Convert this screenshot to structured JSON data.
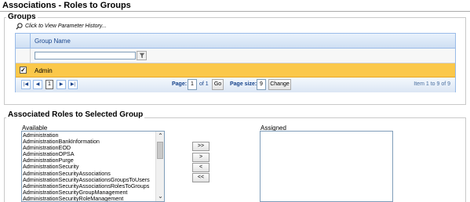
{
  "page": {
    "title": "Associations - Roles to Groups"
  },
  "groups": {
    "legend": "Groups",
    "history_link": "Click to View Parameter History...",
    "grid": {
      "column_header": "Group Name",
      "filter_value": "",
      "rows": [
        {
          "name": "Admin",
          "checked": true
        }
      ]
    },
    "pager": {
      "page_label": "Page:",
      "page_value": "1",
      "of_text": "of 1",
      "go_label": "Go",
      "page_size_label": "Page size:",
      "page_size_value": "9",
      "change_label": "Change",
      "current_page": "1",
      "info": "Item 1 to 9 of 9"
    }
  },
  "roles": {
    "legend": "Associated Roles to Selected Group",
    "available_label": "Available",
    "assigned_label": "Assigned",
    "available_items": [
      "Administration",
      "AdministrationBankInformation",
      "AdministrationEOD",
      "AdministrationOPSA",
      "AdministrationPurge",
      "AdministrationSecurity",
      "AdministrationSecurityAssociations",
      "AdministrationSecurityAssociationsGroupsToUsers",
      "AdministrationSecurityAssociationsRolesToGroups",
      "AdministrationSecurityGroupManagement",
      "AdministrationSecurityRoleManagement"
    ],
    "assigned_items": [],
    "buttons": {
      "add_all": ">>",
      "add": ">",
      "remove": "<",
      "remove_all": "<<"
    }
  }
}
